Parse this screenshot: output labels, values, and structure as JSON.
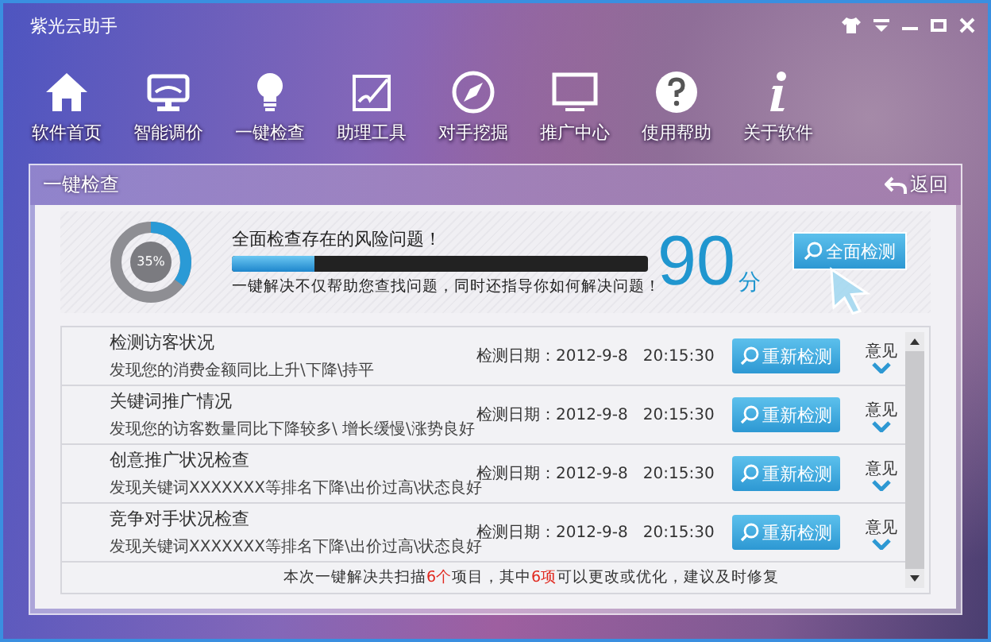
{
  "window": {
    "title": "紫光云助手"
  },
  "nav": [
    {
      "label": "软件首页"
    },
    {
      "label": "智能调价"
    },
    {
      "label": "一键检查"
    },
    {
      "label": "助理工具"
    },
    {
      "label": "对手挖掘"
    },
    {
      "label": "推广中心"
    },
    {
      "label": "使用帮助"
    },
    {
      "label": "关于软件"
    }
  ],
  "panel": {
    "title": "一键检查",
    "back": "返回"
  },
  "summary": {
    "progress_text": "35%",
    "headline": "全面检查存在的风险问题！",
    "level": 0.2,
    "note": "一键解决不仅帮助您查找问题，同时还指导你如何解决问题！",
    "score": "90",
    "score_unit": "分",
    "button": "全面检测"
  },
  "rows": [
    {
      "title": "检测访客状况",
      "desc": "发现您的消费金额同比上升\\下降\\持平",
      "date": "检测日期：2012-9-8   20:15:30",
      "button": "重新检测",
      "opinion": "意见"
    },
    {
      "title": "关键词推广情况",
      "desc": "发现您的访客数量同比下降较多\\ 增长缓慢\\涨势良好",
      "date": "检测日期：2012-9-8   20:15:30",
      "button": "重新检测",
      "opinion": "意见"
    },
    {
      "title": "创意推广状况检查",
      "desc": "发现关键词XXXXXXX等排名下降\\出价过高\\状态良好",
      "date": "检测日期：2012-9-8   20:15:30",
      "button": "重新检测",
      "opinion": "意见"
    },
    {
      "title": "竞争对手状况检查",
      "desc": "发现关键词XXXXXXX等排名下降\\出价过高\\状态良好",
      "date": "检测日期：2012-9-8   20:15:30",
      "button": "重新检测",
      "opinion": "意见"
    }
  ],
  "footer": [
    {
      "text": "本次一键解决共扫描",
      "highlight": false
    },
    {
      "text": "6个",
      "highlight": true
    },
    {
      "text": "项目，其中",
      "highlight": false
    },
    {
      "text": "6项",
      "highlight": true
    },
    {
      "text": "可以更改或优化，建议及时修复",
      "highlight": false
    }
  ]
}
